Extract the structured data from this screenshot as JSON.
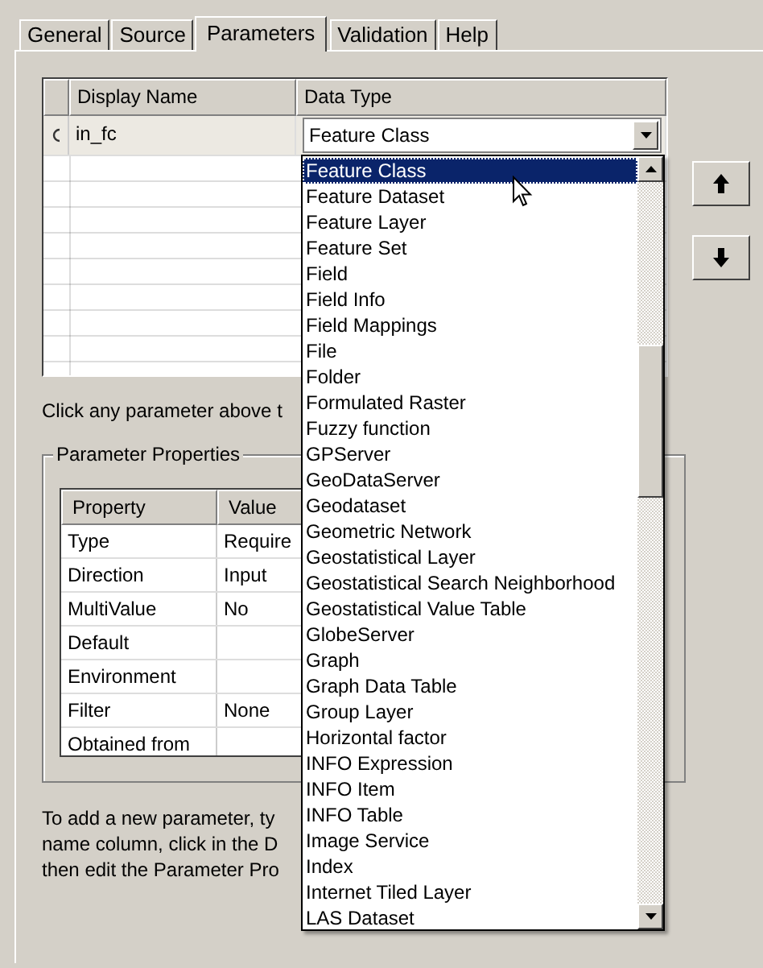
{
  "tabs": [
    {
      "label": "General",
      "selected": false
    },
    {
      "label": "Source",
      "selected": false
    },
    {
      "label": "Parameters",
      "selected": true
    },
    {
      "label": "Validation",
      "selected": false
    },
    {
      "label": "Help",
      "selected": false
    }
  ],
  "parameters_grid": {
    "columns": [
      "Display Name",
      "Data Type"
    ],
    "rows": [
      {
        "display_name": "in_fc",
        "data_type": "Feature Class"
      }
    ]
  },
  "move_buttons": [
    {
      "kind": "up"
    },
    {
      "kind": "down"
    }
  ],
  "hint": "Click any parameter above t",
  "parameter_properties": {
    "title": "Parameter Properties",
    "columns": [
      "Property",
      "Value"
    ],
    "rows": [
      {
        "property": "Type",
        "value": "Require"
      },
      {
        "property": "Direction",
        "value": "Input"
      },
      {
        "property": "MultiValue",
        "value": "No"
      },
      {
        "property": "Default"
      },
      {
        "property": "Environment"
      },
      {
        "property": "Filter",
        "value": "None"
      },
      {
        "property": "Obtained from"
      }
    ]
  },
  "instructions": [
    "To add a new parameter, ty",
    "name column, click in the D",
    "then edit the Parameter Pro"
  ],
  "dropdown": {
    "items": [
      {
        "label": "Feature Class",
        "selected": true
      },
      {
        "label": "Feature Dataset",
        "selected": false
      },
      {
        "label": "Feature Layer",
        "selected": false
      },
      {
        "label": "Feature Set",
        "selected": false
      },
      {
        "label": "Field",
        "selected": false
      },
      {
        "label": "Field Info",
        "selected": false
      },
      {
        "label": "Field Mappings",
        "selected": false
      },
      {
        "label": "File",
        "selected": false
      },
      {
        "label": "Folder",
        "selected": false
      },
      {
        "label": "Formulated Raster",
        "selected": false
      },
      {
        "label": "Fuzzy function",
        "selected": false
      },
      {
        "label": "GPServer",
        "selected": false
      },
      {
        "label": "GeoDataServer",
        "selected": false
      },
      {
        "label": "Geodataset",
        "selected": false
      },
      {
        "label": "Geometric Network",
        "selected": false
      },
      {
        "label": "Geostatistical Layer",
        "selected": false
      },
      {
        "label": "Geostatistical Search Neighborhood",
        "selected": false
      },
      {
        "label": "Geostatistical Value Table",
        "selected": false
      },
      {
        "label": "GlobeServer",
        "selected": false
      },
      {
        "label": "Graph",
        "selected": false
      },
      {
        "label": "Graph Data Table",
        "selected": false
      },
      {
        "label": "Group Layer",
        "selected": false
      },
      {
        "label": "Horizontal factor",
        "selected": false
      },
      {
        "label": "INFO Expression",
        "selected": false
      },
      {
        "label": "INFO Item",
        "selected": false
      },
      {
        "label": "INFO Table",
        "selected": false
      },
      {
        "label": "Image Service",
        "selected": false
      },
      {
        "label": "Index",
        "selected": false
      },
      {
        "label": "Internet Tiled Layer",
        "selected": false
      },
      {
        "label": "LAS Dataset",
        "selected": false
      }
    ]
  }
}
